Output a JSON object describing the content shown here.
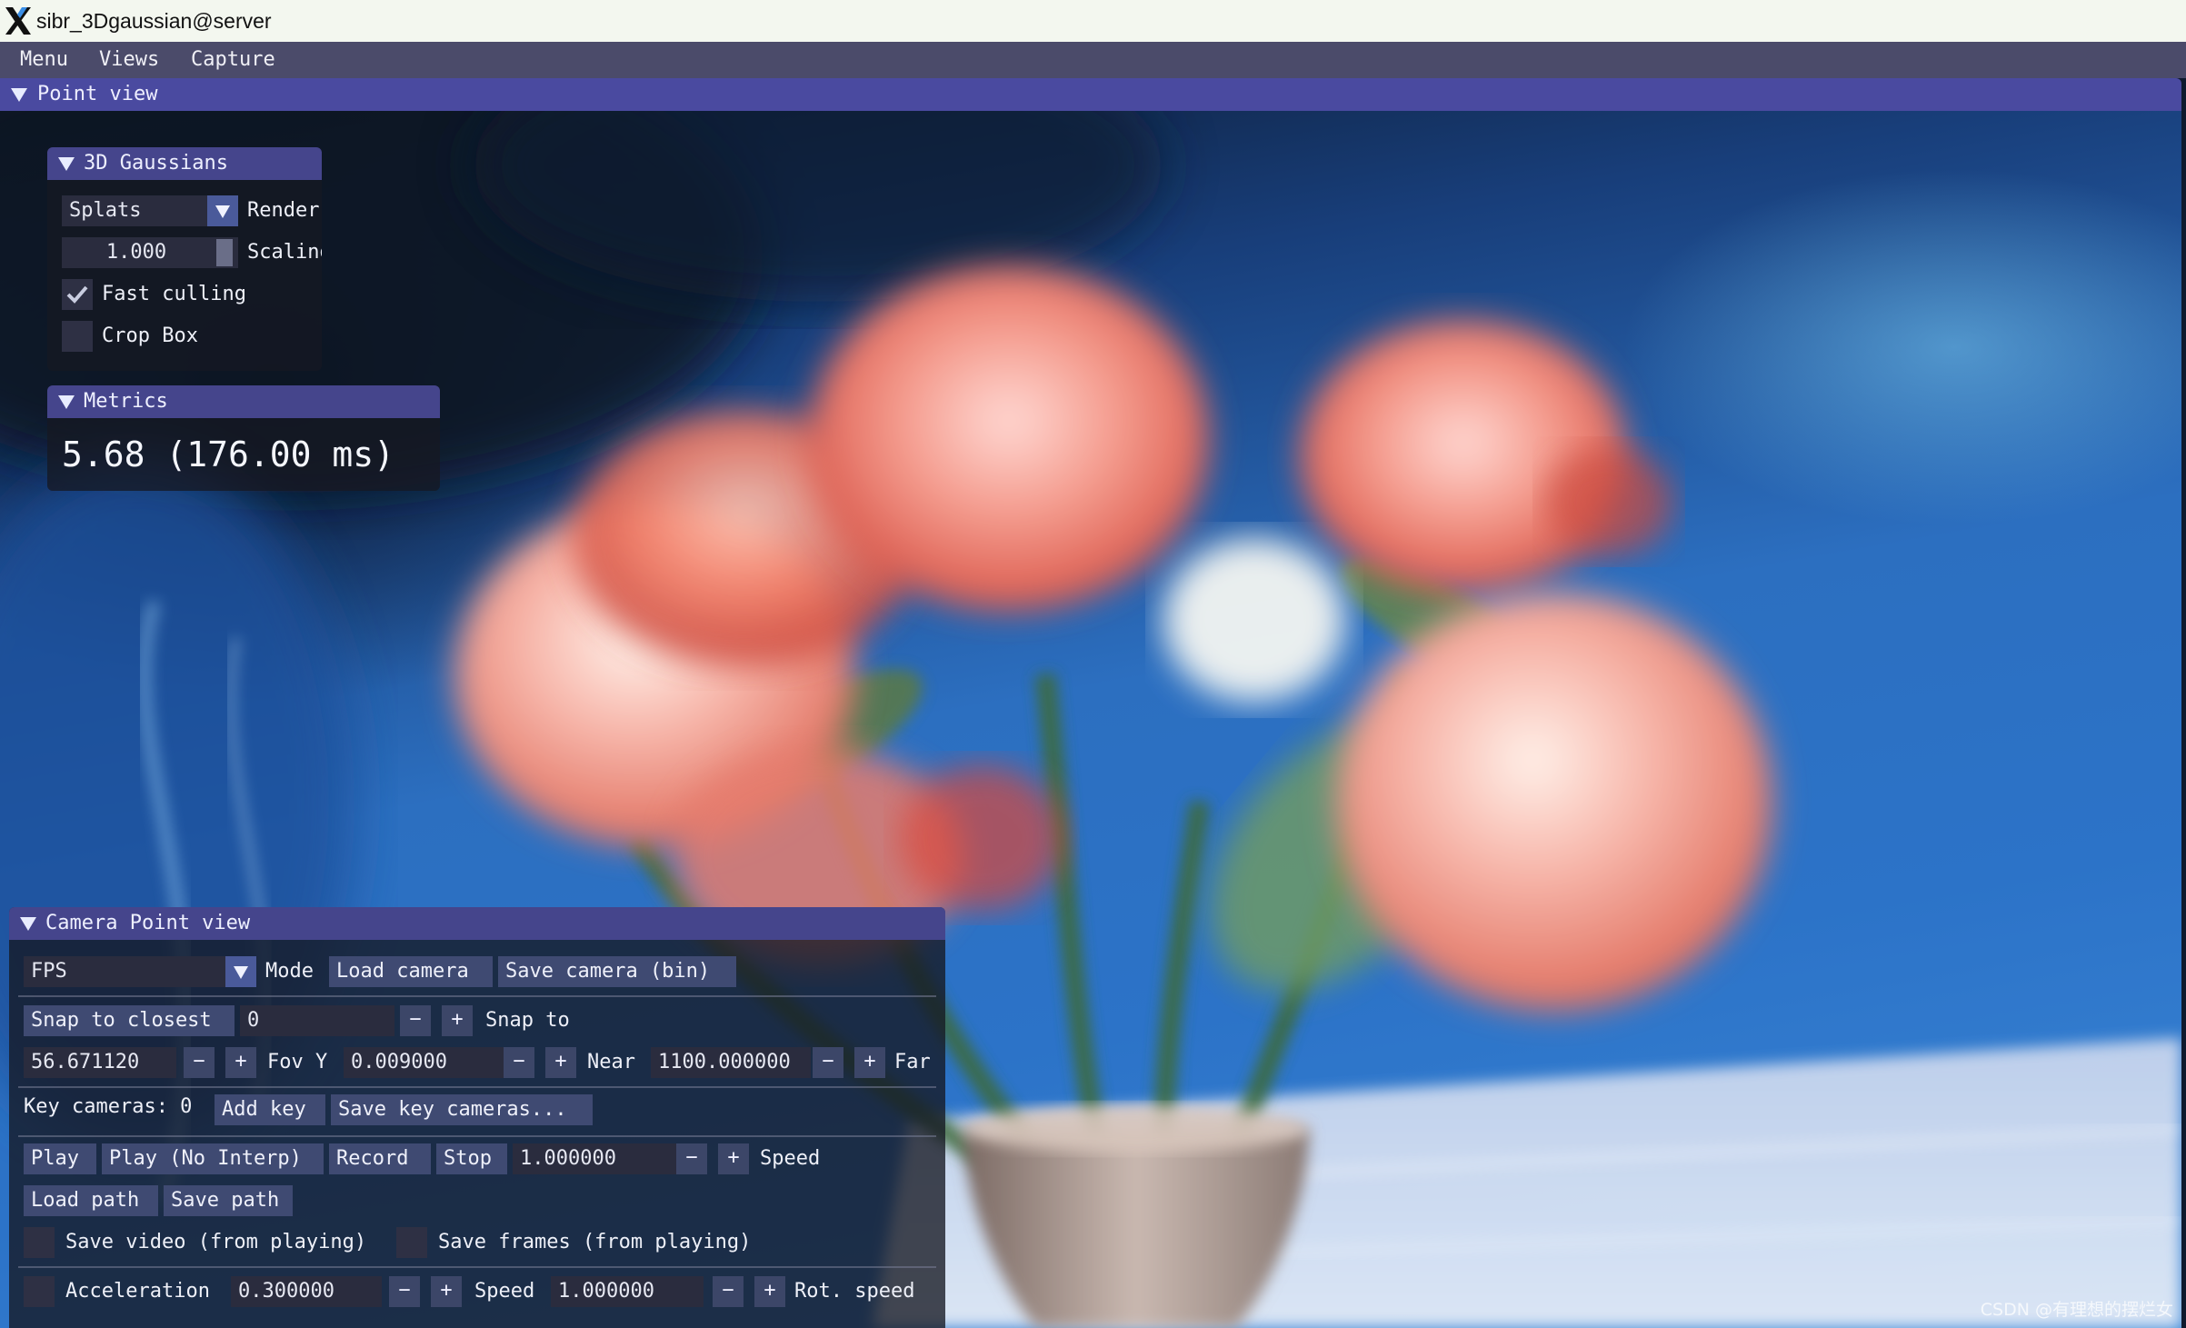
{
  "window": {
    "title": "sibr_3Dgaussian@server",
    "icon": "x11-logo-icon"
  },
  "menubar": {
    "items": [
      "Menu",
      "Views",
      "Capture"
    ]
  },
  "point_view": {
    "header": "Point view"
  },
  "gaussians_panel": {
    "title": "3D Gaussians",
    "render_mode_value": "Splats",
    "render_mode_label": "Render",
    "scaling_value": "1.000",
    "scaling_label": "Scaling",
    "fast_culling_label": "Fast culling",
    "fast_culling_checked": true,
    "crop_box_label": "Crop Box",
    "crop_box_checked": false
  },
  "metrics_panel": {
    "title": "Metrics",
    "fps_text": "5.68 (176.00 ms)"
  },
  "camera_panel": {
    "title": "Camera Point view",
    "mode_value": "FPS",
    "mode_label": "Mode",
    "load_camera": "Load camera",
    "save_camera": "Save camera (bin)",
    "snap_to_closest": "Snap to closest",
    "snap_value": "0",
    "snap_label": "Snap to",
    "fovy_value": "56.671120",
    "fovy_label": "Fov Y",
    "near_value": "0.009000",
    "near_label": "Near",
    "far_value": "1100.000000",
    "far_label": "Far",
    "key_cameras_label": "Key cameras: 0",
    "add_key": "Add key",
    "save_key_cameras": "Save key cameras...",
    "play": "Play",
    "play_no_interp": "Play (No Interp)",
    "record": "Record",
    "stop": "Stop",
    "speed_value": "1.000000",
    "speed_label": "Speed",
    "load_path": "Load path",
    "save_path": "Save path",
    "save_video_label": "Save video (from playing)",
    "save_frames_label": "Save frames (from playing)",
    "acceleration_label": "Acceleration",
    "acceleration_value": "0.300000",
    "speed2_label": "Speed",
    "rot_speed_value": "1.000000",
    "rot_speed_label": "Rot. speed",
    "minus": "−",
    "plus": "+"
  },
  "watermark": "CSDN @有理想的摆烂女",
  "colors": {
    "titlebar_bg": "#f3f7ef",
    "menubar_bg": "#4b4b6a",
    "header_bg": "#4a4aa0",
    "button_bg": "#3f4a72",
    "field_bg": "#2a2c3e"
  }
}
